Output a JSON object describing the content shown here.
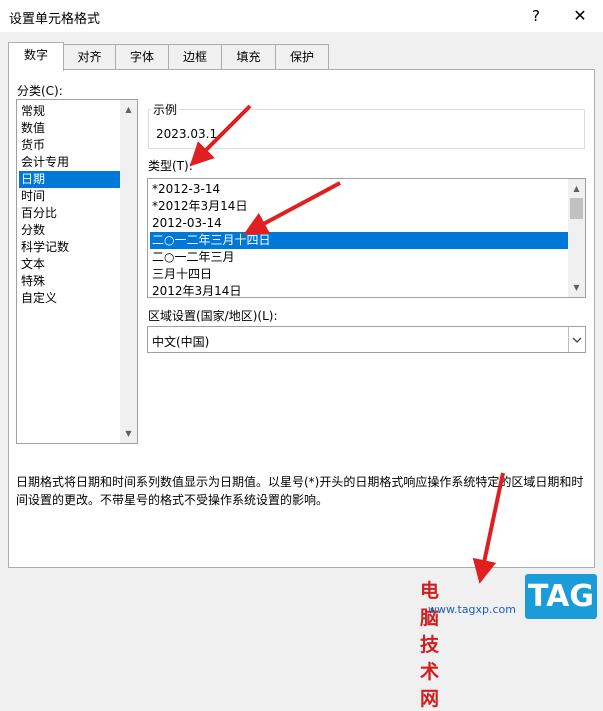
{
  "window": {
    "title": "设置单元格格式",
    "help_label": "?",
    "close_label": "✕"
  },
  "tabs": [
    {
      "label": "数字",
      "active": true
    },
    {
      "label": "对齐"
    },
    {
      "label": "字体"
    },
    {
      "label": "边框"
    },
    {
      "label": "填充"
    },
    {
      "label": "保护"
    }
  ],
  "category": {
    "label": "分类(C):",
    "items": [
      "常规",
      "数值",
      "货币",
      "会计专用",
      "日期",
      "时间",
      "百分比",
      "分数",
      "科学记数",
      "文本",
      "特殊",
      "自定义"
    ],
    "selected": "日期"
  },
  "sample": {
    "label": "示例",
    "value": "2023.03.1"
  },
  "type": {
    "label": "类型(T):",
    "items": [
      "*2012-3-14",
      "*2012年3月14日",
      "2012-03-14",
      "二○一二年三月十四日",
      "二○一二年三月",
      "三月十四日",
      "2012年3月14日"
    ],
    "selected": "二○一二年三月十四日"
  },
  "locale": {
    "label": "区域设置(国家/地区)(L):",
    "value": "中文(中国)"
  },
  "description": "日期格式将日期和时间系列数值显示为日期值。以星号(*)开头的日期格式响应操作系统特定的区域日期和时间设置的更改。不带星号的格式不受操作系统设置的影响。",
  "icons": {
    "scroll_up": "chevron-up-icon",
    "scroll_down": "chevron-down-icon",
    "dropdown": "chevron-down-icon"
  },
  "colors": {
    "selection": "#0078d7",
    "annotation_arrow": "#e02020",
    "watermark_red": "#d21e1e",
    "badge_blue": "#1b9cd8"
  },
  "watermark": {
    "text": "电脑技术网",
    "url": "www.tagxp.com",
    "badge": "TAG"
  }
}
